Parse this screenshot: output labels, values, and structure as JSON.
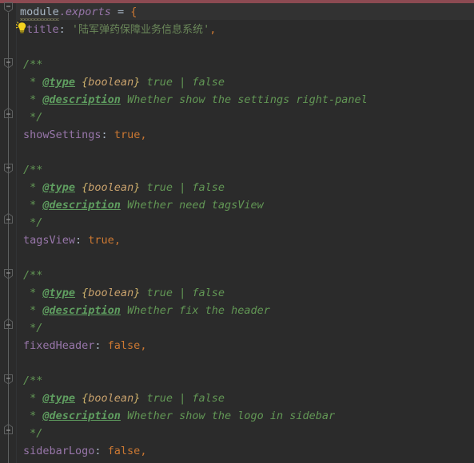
{
  "editor": {
    "theme": "darcula",
    "background": "#2b2b2b",
    "current_line_background": "#323232",
    "gutter_background": "#2b2b2b",
    "top_bar_color": "#8c4a52",
    "font_size_px": 13.5,
    "line_height_px": 22
  },
  "colors": {
    "identifier": "#a9b7c6",
    "property": "#9876aa",
    "keyword": "#cc7832",
    "string": "#6a8759",
    "comment": "#629755",
    "doc_tag": "#5f9e60",
    "doc_type": "#c9a26d",
    "brace": "#cc7832",
    "fold_marker": "#5e6060",
    "squiggle": "#6b6b52"
  },
  "icons": {
    "intention_bulb": "lightbulb-icon",
    "fold_start": "fold-collapse-icon",
    "fold_end": "fold-end-icon"
  },
  "code": {
    "line_01": {
      "module": "module",
      "dot": ".",
      "exports": "exports",
      "equals": " = ",
      "open_brace": "{"
    },
    "line_02": {
      "key": "title",
      "colon": ": ",
      "quote_open": "'",
      "value": "陆军弹药保障业务信息系统",
      "quote_close": "'",
      "comma": ","
    },
    "blocks": [
      {
        "doc_open": "/**",
        "tag_type_star": " * ",
        "tag_type": "@type",
        "tag_type_brace_open": " {",
        "tag_type_name": "boolean",
        "tag_type_brace_close": "}",
        "tag_type_values": " true | false",
        "tag_desc_star": " * ",
        "tag_desc": "@description",
        "tag_desc_text": " Whether show the settings right-panel",
        "doc_close": " */",
        "prop_key": "showSettings",
        "prop_colon": ": ",
        "prop_value": "true",
        "prop_comma": ","
      },
      {
        "doc_open": "/**",
        "tag_type_star": " * ",
        "tag_type": "@type",
        "tag_type_brace_open": " {",
        "tag_type_name": "boolean",
        "tag_type_brace_close": "}",
        "tag_type_values": " true | false",
        "tag_desc_star": " * ",
        "tag_desc": "@description",
        "tag_desc_text": " Whether need tagsView",
        "doc_close": " */",
        "prop_key": "tagsView",
        "prop_colon": ": ",
        "prop_value": "true",
        "prop_comma": ","
      },
      {
        "doc_open": "/**",
        "tag_type_star": " * ",
        "tag_type": "@type",
        "tag_type_brace_open": " {",
        "tag_type_name": "boolean",
        "tag_type_brace_close": "}",
        "tag_type_values": " true | false",
        "tag_desc_star": " * ",
        "tag_desc": "@description",
        "tag_desc_text": " Whether fix the header",
        "doc_close": " */",
        "prop_key": "fixedHeader",
        "prop_colon": ": ",
        "prop_value": "false",
        "prop_comma": ","
      },
      {
        "doc_open": "/**",
        "tag_type_star": " * ",
        "tag_type": "@type",
        "tag_type_brace_open": " {",
        "tag_type_name": "boolean",
        "tag_type_brace_close": "}",
        "tag_type_values": " true | false",
        "tag_desc_star": " * ",
        "tag_desc": "@description",
        "tag_desc_text": " Whether show the logo in sidebar",
        "doc_close": " */",
        "prop_key": "sidebarLogo",
        "prop_colon": ": ",
        "prop_value": "false",
        "prop_comma": ","
      }
    ]
  }
}
